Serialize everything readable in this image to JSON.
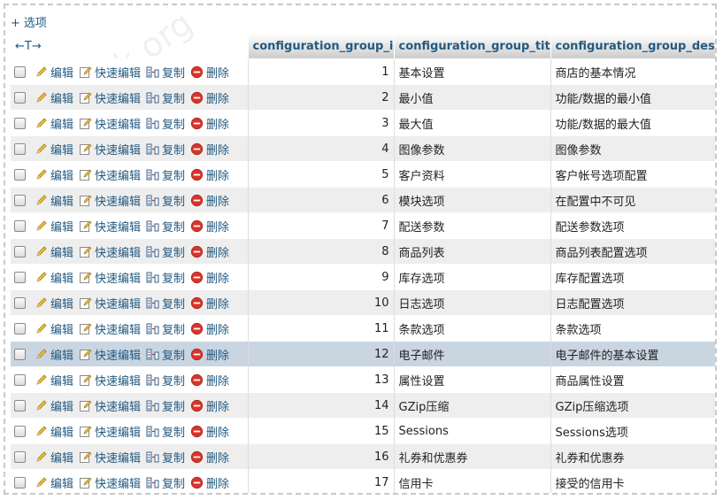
{
  "options_label": "选项",
  "arrows_label": "←T→",
  "columns": {
    "id": "configuration_group_id",
    "title": "configuration_group_title",
    "desc": "configuration_group_descr"
  },
  "actions": {
    "edit": "编辑",
    "quick_edit": "快速编辑",
    "copy": "复制",
    "delete": "删除"
  },
  "rows": [
    {
      "id": "1",
      "title": "基本设置",
      "desc": "商店的基本情况"
    },
    {
      "id": "2",
      "title": "最小值",
      "desc": "功能/数据的最小值"
    },
    {
      "id": "3",
      "title": "最大值",
      "desc": "功能/数据的最大值"
    },
    {
      "id": "4",
      "title": "图像参数",
      "desc": "图像参数"
    },
    {
      "id": "5",
      "title": "客户资料",
      "desc": "客户帐号选项配置"
    },
    {
      "id": "6",
      "title": "模块选项",
      "desc": "在配置中不可见"
    },
    {
      "id": "7",
      "title": "配送参数",
      "desc": "配送参数选项"
    },
    {
      "id": "8",
      "title": "商品列表",
      "desc": "商品列表配置选项"
    },
    {
      "id": "9",
      "title": "库存选项",
      "desc": "库存配置选项"
    },
    {
      "id": "10",
      "title": "日志选项",
      "desc": "日志配置选项"
    },
    {
      "id": "11",
      "title": "条款选项",
      "desc": "条款选项"
    },
    {
      "id": "12",
      "title": "电子邮件",
      "desc": "电子邮件的基本设置"
    },
    {
      "id": "13",
      "title": "属性设置",
      "desc": "商品属性设置"
    },
    {
      "id": "14",
      "title": "GZip压缩",
      "desc": "GZip压缩选项"
    },
    {
      "id": "15",
      "title": "Sessions",
      "desc": "Sessions选项"
    },
    {
      "id": "16",
      "title": "礼券和优惠券",
      "desc": "礼券和优惠券"
    },
    {
      "id": "17",
      "title": "信用卡",
      "desc": "接受的信用卡"
    }
  ],
  "highlighted_row_id": "12",
  "watermark": "zcbk.org",
  "colors": {
    "link": "#235a81",
    "row_even": "#eeeeee",
    "row_marked": "#c9d5e1",
    "delete_red": "#d9342b"
  },
  "icons": {
    "edit": "pencil-icon",
    "quick_edit": "quick-edit-icon",
    "copy": "copy-icon",
    "delete": "delete-icon"
  }
}
